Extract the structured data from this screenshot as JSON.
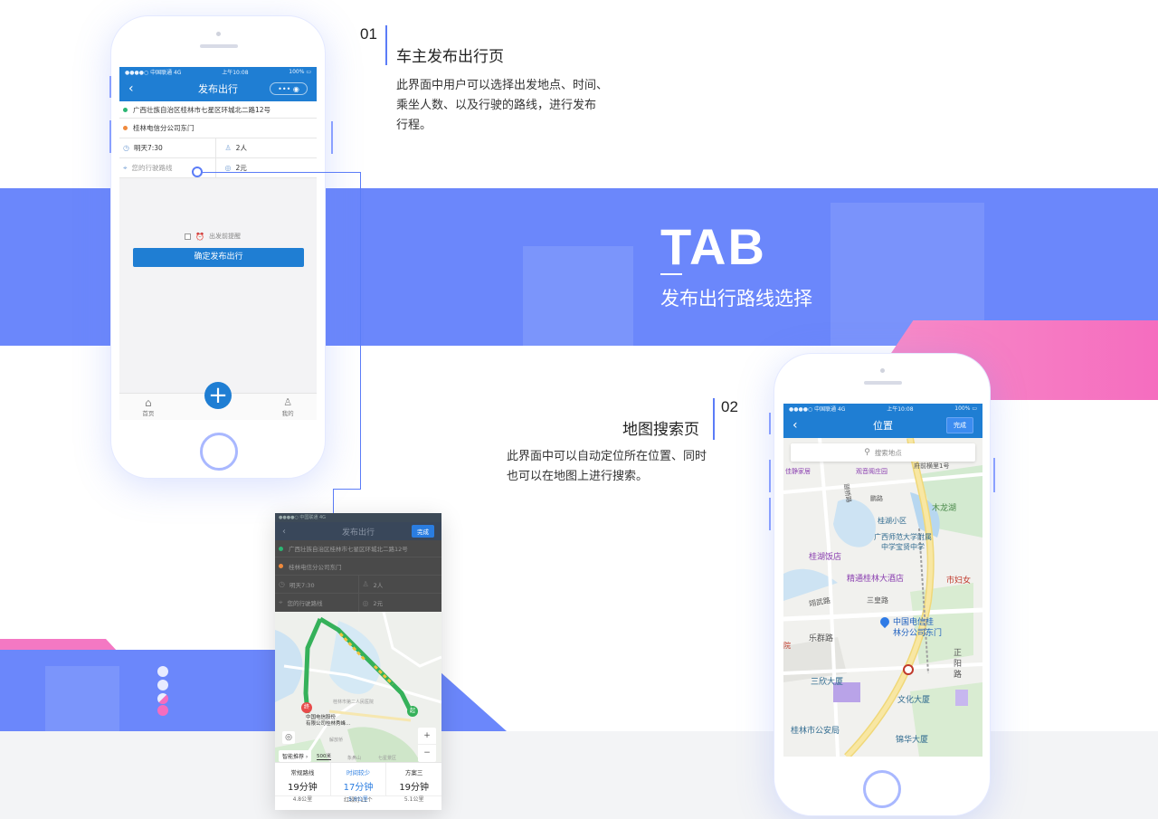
{
  "colors": {
    "accent": "#6b87fb",
    "pink": "#f56dbf",
    "app_blue": "#1f7ed3"
  },
  "banner": {
    "title": "TAB",
    "subtitle": "发布出行路线选择"
  },
  "section1": {
    "num": "01",
    "heading": "车主发布出行页",
    "desc_lines": [
      "此界面中用户可以选择出发地点、时间、",
      "乘坐人数、以及行驶的路线，进行发布",
      "行程。"
    ]
  },
  "section2": {
    "num": "02",
    "heading": "地图搜索页",
    "desc_lines": [
      "此界面中可以自动定位所在位置、同时",
      "也可以在地图上进行搜索。"
    ]
  },
  "phone1": {
    "status": {
      "carrier": "●●●●○ 中国联通  4G",
      "time": "上午10:08",
      "battery": "100% ▭"
    },
    "nav": {
      "back": "‹",
      "title": "发布出行",
      "capsule": "•••  ◉"
    },
    "form": {
      "origin": "广西壮族自治区桂林市七星区环城北二路12号",
      "destination": "桂林电信分公司东门",
      "time": "明天7:30",
      "seats": "2人",
      "route_placeholder": "您的行驶路线",
      "price": "2元"
    },
    "remind_label": "出发前提醒",
    "confirm_label": "确定发布出行",
    "tabbar": {
      "home": "首页",
      "mine": "我的",
      "fab": "+"
    }
  },
  "phone_mid": {
    "status": "●●●●○ 中国联通  4G",
    "nav": {
      "back": "‹",
      "title": "发布出行",
      "done": "完成"
    },
    "form": {
      "origin": "广西壮族自治区桂林市七星区环城北二路12号",
      "destination": "桂林电信分公司东门",
      "time": "明天7:30",
      "seats": "2人",
      "route_placeholder": "您的行驶路线",
      "price": "2元"
    },
    "map": {
      "start_marker": "终",
      "end_marker": "起",
      "dest_label_1": "中国电信股份",
      "dest_label_2": "有限公司桂林秀峰...",
      "place_1": "桂林市第二人民医院",
      "place_2": "解放桥",
      "place_3": "象鼻山",
      "place_4": "七星景区",
      "smart_recommend": "智能推荐 ›",
      "scale": "500米",
      "zoom_in": "+",
      "zoom_out": "−"
    },
    "routes": [
      {
        "name": "常规路线",
        "time": "19分钟",
        "dist": "4.8公里"
      },
      {
        "name": "时间较少",
        "time": "17分钟",
        "dist": "5.8公里"
      },
      {
        "name": "方案三",
        "time": "19分钟",
        "dist": "5.1公里"
      }
    ],
    "traffic_lights": "红绿灯11个"
  },
  "phone2": {
    "status": {
      "carrier": "●●●●○ 中国联通  4G",
      "time": "上午10:08",
      "battery": "100% ▭"
    },
    "nav": {
      "back": "‹",
      "title": "位置",
      "done": "完成"
    },
    "search_placeholder": "搜索地点",
    "map_labels": {
      "hotel_top": "府前横里1号",
      "guanyin": "观音阁庄园",
      "pengcheng": "鹏路",
      "lanqiao": "颐桥路",
      "mulong_lake": "木龙湖",
      "guihu_xiaoqu": "桂湖小区",
      "gx_normal_1": "广西师范大学附属",
      "gx_normal_2": "中学宝贤中学",
      "guihu_hotel": "桂湖饭店",
      "jingtong_hotel": "精通桂林大酒店",
      "hospital": "市妇女",
      "xiwu": "翊武路",
      "sanhuang": "三皇路",
      "dest_1": "中国电信桂",
      "dest_2": "林分公司东门",
      "lequn": "乐群路",
      "zhengyang_1": "正",
      "zhengyang_2": "阳",
      "zhengyang_3": "路",
      "sanxin": "三欣大厦",
      "wenhua": "文化大厦",
      "police": "桂林市公安局",
      "jinhua": "锦华大厦",
      "left_edge": "院",
      "left_top": "佳静家居"
    }
  }
}
